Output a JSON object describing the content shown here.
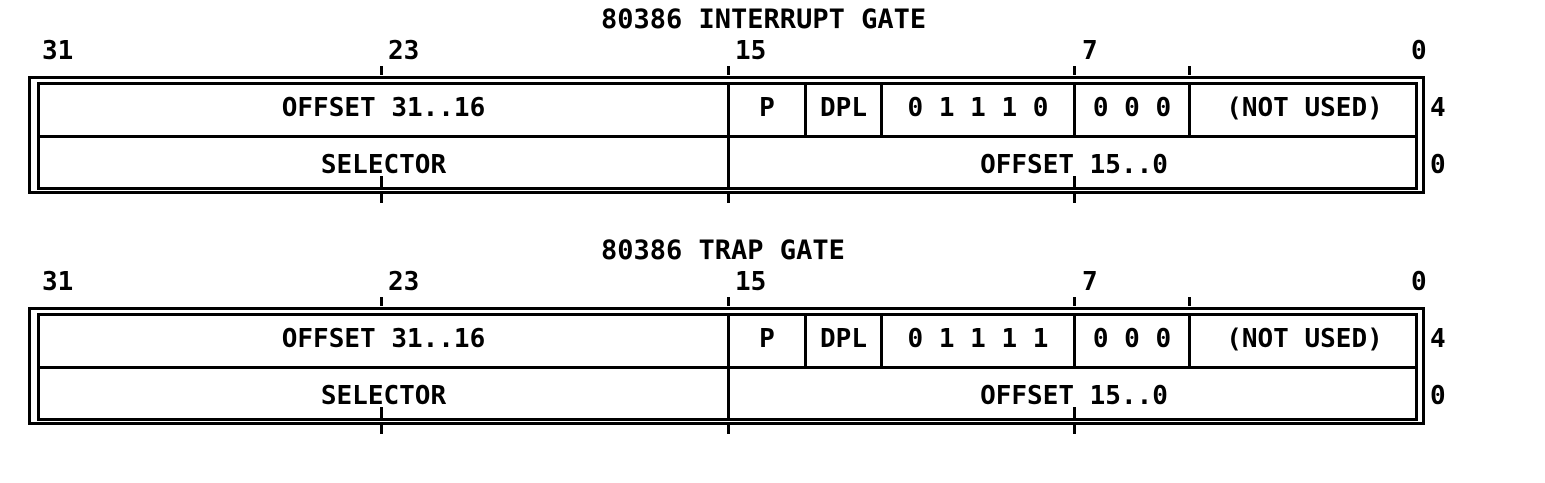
{
  "gates": [
    {
      "title": "80386 INTERRUPT GATE",
      "bits": {
        "b31": "31",
        "b23": "23",
        "b15": "15",
        "b7": "7",
        "b0": "0"
      },
      "row_upper": {
        "offset_high": "OFFSET 31..16",
        "p": "P",
        "dpl": "DPL",
        "type": "0 1 1 1 0",
        "zeros": "0 0 0",
        "unused": "(NOT USED)",
        "side": "4"
      },
      "row_lower": {
        "selector": "SELECTOR",
        "offset_low": "OFFSET 15..0",
        "side": "0"
      }
    },
    {
      "title": "80386 TRAP GATE",
      "bits": {
        "b31": "31",
        "b23": "23",
        "b15": "15",
        "b7": "7",
        "b0": "0"
      },
      "row_upper": {
        "offset_high": "OFFSET 31..16",
        "p": "P",
        "dpl": "DPL",
        "type": "0 1 1 1 1",
        "zeros": "0 0 0",
        "unused": "(NOT USED)",
        "side": "4"
      },
      "row_lower": {
        "selector": "SELECTOR",
        "offset_low": "OFFSET 15..0",
        "side": "0"
      }
    }
  ]
}
